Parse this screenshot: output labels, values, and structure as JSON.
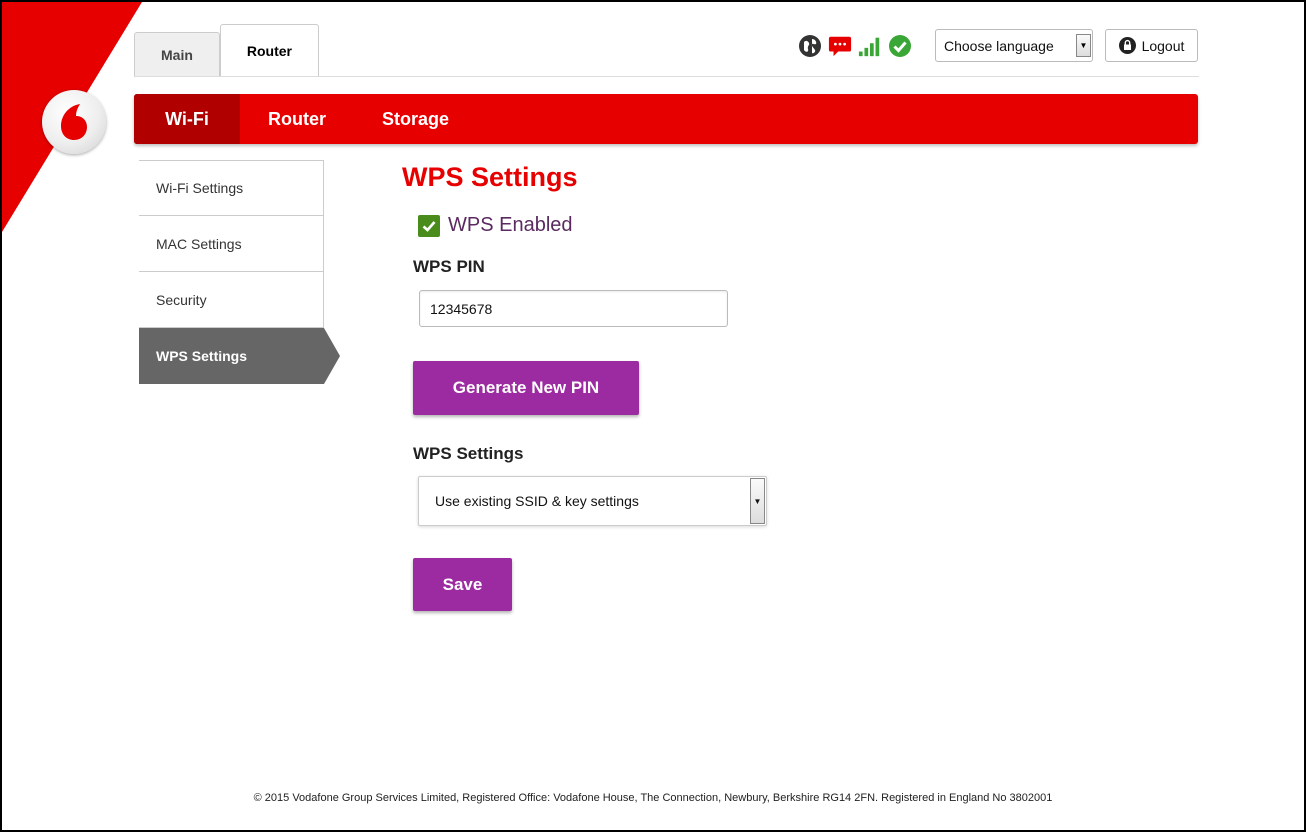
{
  "top_tabs": [
    {
      "label": "Main",
      "active": false
    },
    {
      "label": "Router",
      "active": true
    }
  ],
  "status_icons": [
    "globe-icon",
    "message-icon",
    "signal-bars-icon",
    "connected-check-icon"
  ],
  "colors": {
    "brand_red": "#e60000",
    "dark_red": "#b00000",
    "purple": "#9c2aa0",
    "green": "#4a8c1c"
  },
  "language_select": {
    "value": "Choose language"
  },
  "logout": {
    "label": "Logout"
  },
  "nav": [
    {
      "label": "Wi-Fi",
      "active": true
    },
    {
      "label": "Router",
      "active": false
    },
    {
      "label": "Storage",
      "active": false
    }
  ],
  "sidebar": {
    "items": [
      {
        "label": "Wi-Fi Settings"
      },
      {
        "label": "MAC Settings"
      },
      {
        "label": "Security"
      },
      {
        "label": "WPS Settings",
        "active": true
      }
    ]
  },
  "main": {
    "title": "WPS Settings",
    "wps_enabled_label": "WPS Enabled",
    "wps_enabled_checked": true,
    "pin_label": "WPS PIN",
    "pin_value": "12345678",
    "generate_button": "Generate New PIN",
    "settings_label": "WPS Settings",
    "settings_select_value": "Use existing SSID & key settings",
    "save_button": "Save"
  },
  "footer": {
    "text": "© 2015 Vodafone Group Services Limited, Registered Office: Vodafone House, The Connection, Newbury, Berkshire RG14 2FN. Registered in England No 3802001"
  }
}
